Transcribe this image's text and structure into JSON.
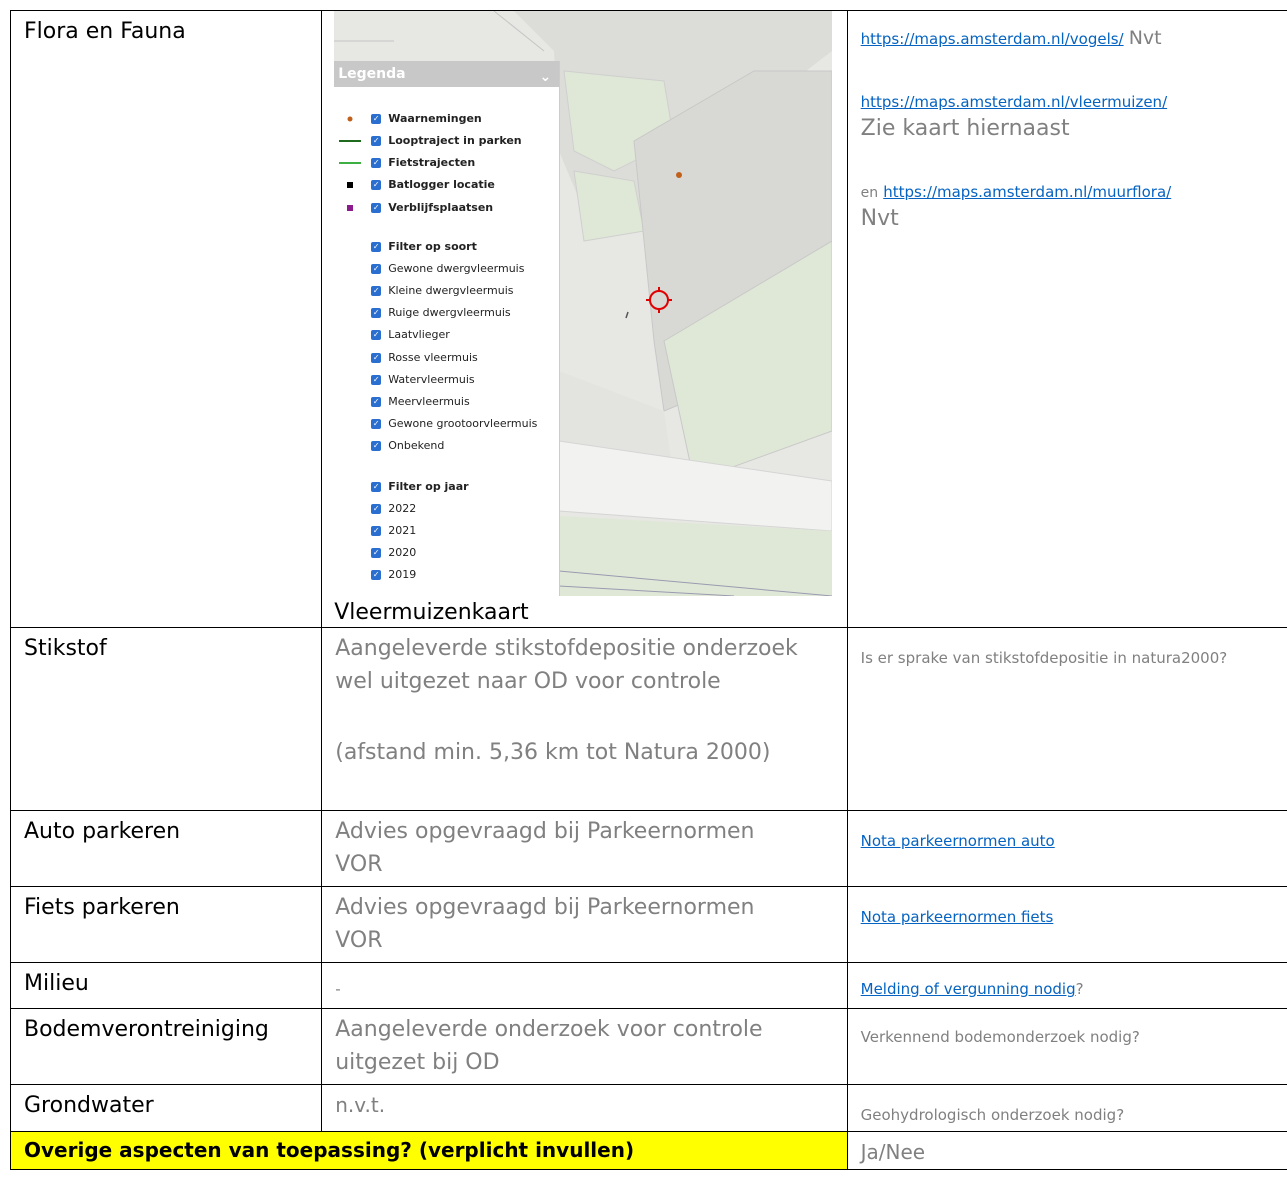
{
  "rows": {
    "flora": {
      "label": "Flora en Fauna",
      "caption": "Vleermuizenkaart",
      "link_vogels": "https://maps.amsterdam.nl/vogels/",
      "vogels_value": "Nvt",
      "link_vleermuizen": "https://maps.amsterdam.nl/vleermuizen/",
      "vleermuizen_value": "Zie kaart hiernaast",
      "en": "en",
      "link_muurflora": "https://maps.amsterdam.nl/muurflora/",
      "muurflora_value": "Nvt"
    },
    "stikstof": {
      "label": "Stikstof",
      "value_1": "Aangeleverde stikstofdepositie onderzoek wel uitgezet naar OD voor controle",
      "value_2": "(afstand min. 5,36 km tot Natura 2000)",
      "hint": "Is er sprake van stikstofdepositie in natura2000?"
    },
    "auto": {
      "label": "Auto parkeren",
      "value": "Advies opgevraagd bij Parkeernormen VOR",
      "hint_link": "Nota parkeernormen auto"
    },
    "fiets": {
      "label": "Fiets parkeren",
      "value": "Advies opgevraagd bij Parkeernormen VOR",
      "hint_link": "Nota parkeernormen fiets"
    },
    "milieu": {
      "label": "Milieu",
      "value": "-",
      "hint_link": "Melding of vergunning nodig",
      "hint_suffix": "?"
    },
    "bodem": {
      "label": "Bodemverontreiniging",
      "value": "Aangeleverde onderzoek voor controle uitgezet bij OD",
      "hint": "Verkennend bodemonderzoek nodig?"
    },
    "grondwater": {
      "label": "Grondwater",
      "value": "n.v.t.",
      "hint": "Geohydrologisch onderzoek nodig?"
    },
    "overige": {
      "label": "Overige aspecten van toepassing? (verplicht invullen)",
      "value": "Ja/Nee"
    }
  },
  "legend": {
    "title": "Legenda",
    "layers": [
      "Waarnemingen",
      "Looptraject in parken",
      "Fietstrajecten",
      "Batlogger locatie",
      "Verblijfsplaatsen"
    ],
    "filter_soort": "Filter op soort",
    "soorten": [
      "Gewone dwergvleermuis",
      "Kleine dwergvleermuis",
      "Ruige dwergvleermuis",
      "Laatvlieger",
      "Rosse vleermuis",
      "Watervleermuis",
      "Meervleermuis",
      "Gewone grootoorvleermuis",
      "Onbekend"
    ],
    "filter_jaar": "Filter op jaar",
    "jaren": [
      "2022",
      "2021",
      "2020",
      "2019"
    ],
    "colors": {
      "waarnemingen": "#c0601a",
      "looptraject": "#1e6b1e",
      "fietstrajecten": "#3cb043",
      "batlogger": "#000000",
      "verblijfsplaatsen": "#8b1a8b",
      "checkbox": "#2a6fcf",
      "marker": "#e00000"
    }
  }
}
